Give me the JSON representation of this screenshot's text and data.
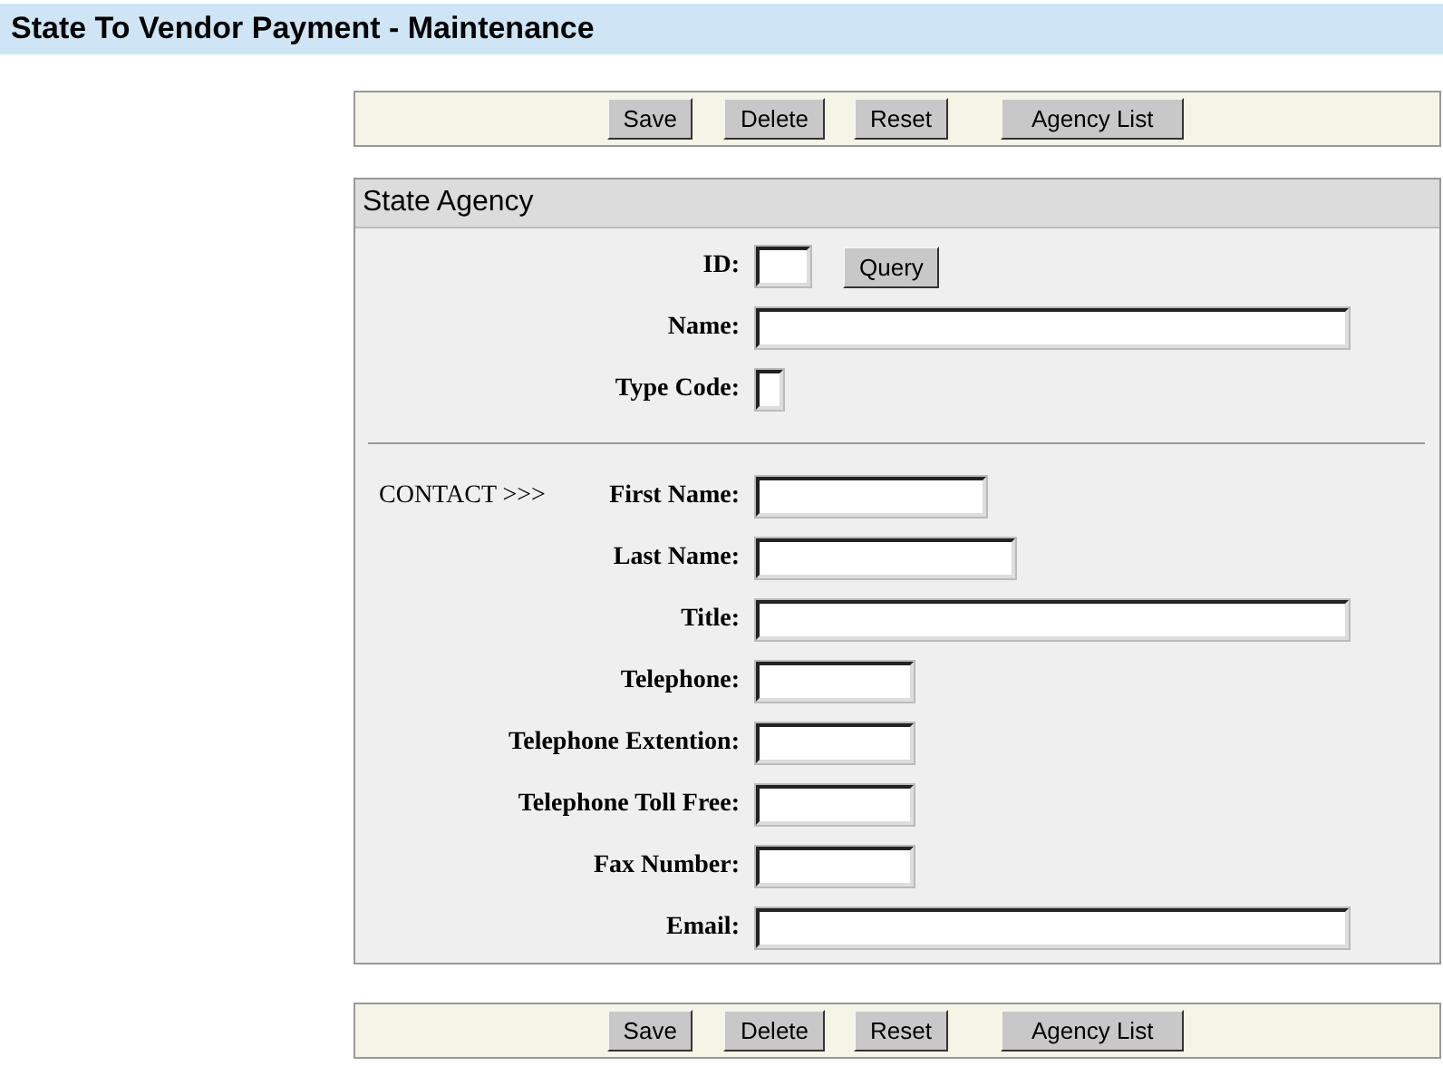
{
  "title": "State To Vendor Payment - Maintenance",
  "toolbar_top": {
    "buttons": [
      "Save",
      "Delete",
      "Reset",
      "Agency List"
    ]
  },
  "panel": {
    "title": "State Agency",
    "agency_fields": [
      {
        "label": "ID:",
        "button": "Query"
      },
      {
        "label": "Name:"
      },
      {
        "label": "Type Code:"
      }
    ],
    "contact_prefix": "CONTACT >>>",
    "contact_fields": [
      {
        "label": "First Name:"
      },
      {
        "label": "Last Name:"
      },
      {
        "label": "Title:"
      },
      {
        "label": "Telephone:"
      },
      {
        "label": "Telephone Extention:"
      },
      {
        "label": "Telephone Toll Free:"
      },
      {
        "label": "Fax Number:"
      },
      {
        "label": "Email:"
      }
    ]
  },
  "toolbar_bottom": {
    "buttons": [
      "Save",
      "Delete",
      "Reset",
      "Agency List"
    ]
  }
}
